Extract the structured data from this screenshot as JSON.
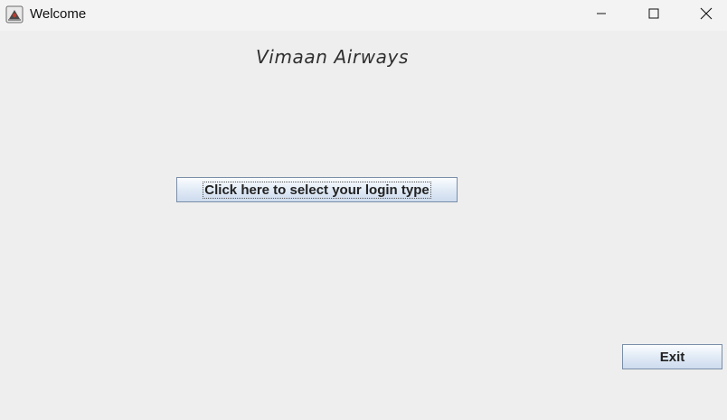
{
  "window": {
    "title": "Welcome",
    "app_icon": "java-app-icon",
    "controls": {
      "minimize_icon": "minimize-icon",
      "maximize_icon": "maximize-icon",
      "close_icon": "close-icon"
    }
  },
  "main": {
    "brand": "Vimaan Airways",
    "login_button_label": "Click here to select your login type",
    "exit_button_label": "Exit"
  },
  "colors": {
    "background": "#eeeeee",
    "button_border": "#7a8ea8",
    "button_gradient_top": "#fbfdff",
    "button_gradient_bottom": "#cddbee"
  }
}
